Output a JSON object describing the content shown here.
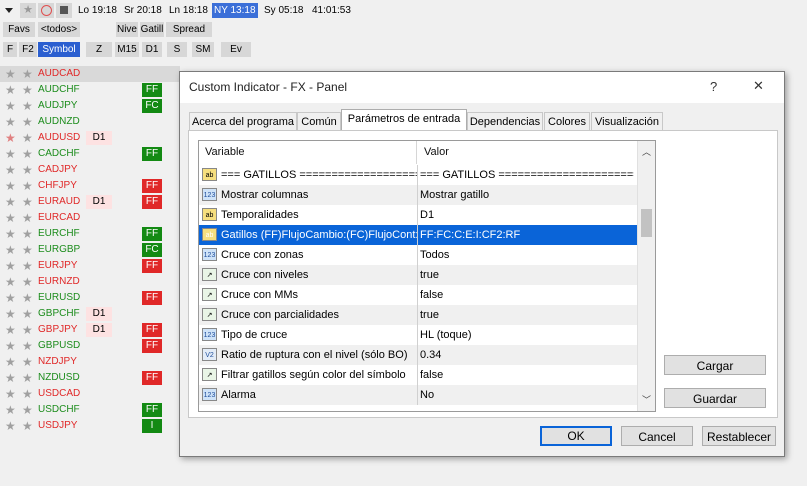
{
  "sessions": {
    "london": "Lo 19:18",
    "sydney_prev": "Sr 20:18",
    "ln": "Ln 18:18",
    "ny": "NY 13:18",
    "sydney": "Sy 05:18",
    "clock": "41:01:53"
  },
  "toolbar": {
    "favs": "Favs",
    "todos": "<todos>",
    "nivel": "Nive",
    "gatillo": "Gatill",
    "spread": "Spread",
    "col_f": "F",
    "col_f2": "F2",
    "col_symbol": "Symbol",
    "col_z": "Z",
    "col_m15": "M15",
    "col_d1": "D1",
    "col_s": "S",
    "col_sm": "SM",
    "col_ev": "Ev"
  },
  "symbols": [
    {
      "name": "AUDCAD",
      "color": "red",
      "d1": "",
      "ff": "",
      "ffc": ""
    },
    {
      "name": "AUDCHF",
      "color": "green",
      "d1": "",
      "ff": "FF",
      "ffc": "g"
    },
    {
      "name": "AUDJPY",
      "color": "green",
      "d1": "",
      "ff": "FC",
      "ffc": "g"
    },
    {
      "name": "AUDNZD",
      "color": "green",
      "d1": "",
      "ff": "",
      "ffc": ""
    },
    {
      "name": "AUDUSD",
      "color": "red",
      "d1": "D1",
      "ff": "",
      "ffc": ""
    },
    {
      "name": "CADCHF",
      "color": "green",
      "d1": "",
      "ff": "FF",
      "ffc": "g"
    },
    {
      "name": "CADJPY",
      "color": "red",
      "d1": "",
      "ff": "",
      "ffc": ""
    },
    {
      "name": "CHFJPY",
      "color": "red",
      "d1": "",
      "ff": "FF",
      "ffc": "r"
    },
    {
      "name": "EURAUD",
      "color": "red",
      "d1": "D1",
      "ff": "FF",
      "ffc": "r"
    },
    {
      "name": "EURCAD",
      "color": "red",
      "d1": "",
      "ff": "",
      "ffc": ""
    },
    {
      "name": "EURCHF",
      "color": "green",
      "d1": "",
      "ff": "FF",
      "ffc": "g"
    },
    {
      "name": "EURGBP",
      "color": "green",
      "d1": "",
      "ff": "FC",
      "ffc": "g"
    },
    {
      "name": "EURJPY",
      "color": "red",
      "d1": "",
      "ff": "FF",
      "ffc": "r"
    },
    {
      "name": "EURNZD",
      "color": "red",
      "d1": "",
      "ff": "",
      "ffc": ""
    },
    {
      "name": "EURUSD",
      "color": "green",
      "d1": "",
      "ff": "FF",
      "ffc": "r"
    },
    {
      "name": "GBPCHF",
      "color": "green",
      "d1": "D1",
      "ff": "",
      "ffc": ""
    },
    {
      "name": "GBPJPY",
      "color": "red",
      "d1": "D1",
      "ff": "FF",
      "ffc": "r"
    },
    {
      "name": "GBPUSD",
      "color": "green",
      "d1": "",
      "ff": "FF",
      "ffc": "r"
    },
    {
      "name": "NZDJPY",
      "color": "red",
      "d1": "",
      "ff": "",
      "ffc": ""
    },
    {
      "name": "NZDUSD",
      "color": "green",
      "d1": "",
      "ff": "FF",
      "ffc": "r"
    },
    {
      "name": "USDCAD",
      "color": "red",
      "d1": "",
      "ff": "",
      "ffc": ""
    },
    {
      "name": "USDCHF",
      "color": "green",
      "d1": "",
      "ff": "FF",
      "ffc": "g"
    },
    {
      "name": "USDJPY",
      "color": "red",
      "d1": "",
      "ff": "I",
      "ffc": "g"
    }
  ],
  "dialog": {
    "title": "Custom Indicator - FX - Panel",
    "help": "?",
    "close": "✕",
    "tabs": [
      "Acerca del programa",
      "Común",
      "Parámetros de entrada",
      "Dependencias",
      "Colores",
      "Visualización"
    ],
    "col_variable": "Variable",
    "col_valor": "Valor",
    "params": [
      {
        "icon": "ab",
        "type": "abi",
        "name": "=== GATILLOS ===================...",
        "value": "=== GATILLOS =======================..."
      },
      {
        "icon": "123",
        "type": "num",
        "name": "Mostrar columnas",
        "value": "Mostrar gatillo"
      },
      {
        "icon": "ab",
        "type": "abi",
        "name": "Temporalidades",
        "value": "D1"
      },
      {
        "icon": "ab",
        "type": "abi",
        "name": "Gatillos (FF)FlujoCambio:(FC)FlujoCont:(...",
        "value": "FF:FC:C:E:I:CF2:RF"
      },
      {
        "icon": "123",
        "type": "num",
        "name": "Cruce con zonas",
        "value": "Todos"
      },
      {
        "icon": "↗",
        "type": "bool",
        "name": "Cruce con niveles",
        "value": "true"
      },
      {
        "icon": "↗",
        "type": "bool",
        "name": "Cruce con MMs",
        "value": "false"
      },
      {
        "icon": "↗",
        "type": "bool",
        "name": "Cruce con parcialidades",
        "value": "true"
      },
      {
        "icon": "123",
        "type": "num",
        "name": "Tipo de cruce",
        "value": "HL (toque)"
      },
      {
        "icon": "V2",
        "type": "enum",
        "name": "Ratio de ruptura con el nivel (sólo BO)",
        "value": "0.34"
      },
      {
        "icon": "↗",
        "type": "bool",
        "name": "Filtrar gatillos según color del símbolo",
        "value": "false"
      },
      {
        "icon": "123",
        "type": "num",
        "name": "Alarma",
        "value": "No"
      }
    ],
    "load": "Cargar",
    "save": "Guardar",
    "ok": "OK",
    "cancel": "Cancel",
    "reset": "Restablecer"
  },
  "colors": {
    "accent": "#0a64d8",
    "green": "#138a13",
    "red": "#e02828"
  }
}
